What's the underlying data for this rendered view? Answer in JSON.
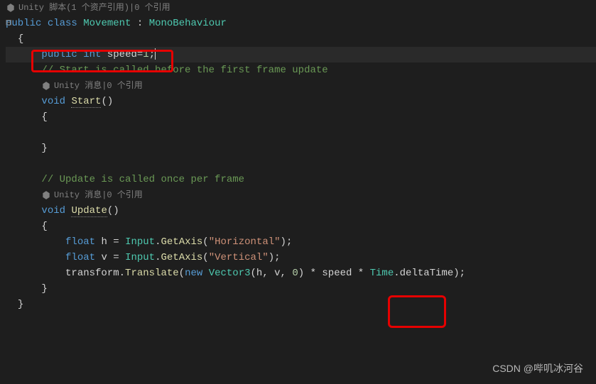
{
  "codelens": {
    "script_ref": "Unity 脚本(1 个资产引用)|0 个引用",
    "msg_ref1": "Unity 消息|0 个引用",
    "msg_ref2": "Unity 消息|0 个引用"
  },
  "code": {
    "class_decl_1": "public",
    "class_decl_2": "class",
    "class_name": "Movement",
    "class_colon": ":",
    "base_class": "MonoBehaviour",
    "brace_open": "{",
    "brace_close": "}",
    "field_pub": "public",
    "field_type": "int",
    "field_name": "speed",
    "field_eq": "=",
    "field_val": "1",
    "semicolon": ";",
    "comment_start": "// Start is called before the first frame update",
    "void_kw": "void",
    "start_fn": "Start",
    "parens": "()",
    "comment_update": "// Update is called once per frame",
    "update_fn": "Update",
    "float_kw": "float",
    "h_var": "h",
    "v_var": "v",
    "eq": "=",
    "input_cls": "Input",
    "getaxis": "GetAxis",
    "horiz_str": "\"Horizontal\"",
    "vert_str": "\"Vertical\"",
    "transform_ident": "transform",
    "translate_fn": "Translate",
    "new_kw": "new",
    "vector3": "Vector3",
    "vec_args_open": "(",
    "vec_h": "h",
    "comma": ", ",
    "vec_v": "v",
    "vec_zero": "0",
    "vec_args_close": ")",
    "mult": " * ",
    "speed_ref": "speed",
    "time_cls": "Time",
    "dot": ".",
    "deltatime": "deltaTime",
    "close_paren_semi": ");"
  },
  "watermark": "CSDN @哔叽冰河谷"
}
